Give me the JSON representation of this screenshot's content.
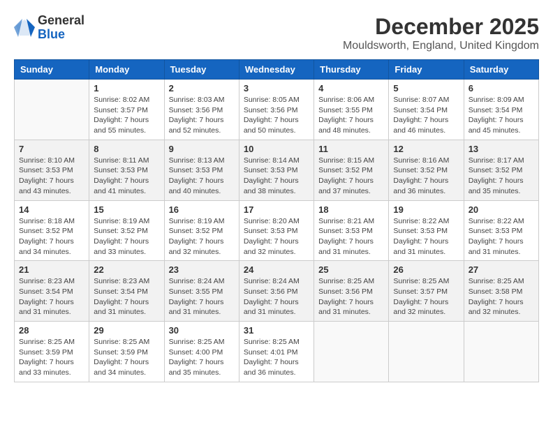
{
  "logo": {
    "general": "General",
    "blue": "Blue"
  },
  "title": "December 2025",
  "location": "Mouldsworth, England, United Kingdom",
  "days_of_week": [
    "Sunday",
    "Monday",
    "Tuesday",
    "Wednesday",
    "Thursday",
    "Friday",
    "Saturday"
  ],
  "weeks": [
    [
      {
        "day": "",
        "info": ""
      },
      {
        "day": "1",
        "info": "Sunrise: 8:02 AM\nSunset: 3:57 PM\nDaylight: 7 hours\nand 55 minutes."
      },
      {
        "day": "2",
        "info": "Sunrise: 8:03 AM\nSunset: 3:56 PM\nDaylight: 7 hours\nand 52 minutes."
      },
      {
        "day": "3",
        "info": "Sunrise: 8:05 AM\nSunset: 3:56 PM\nDaylight: 7 hours\nand 50 minutes."
      },
      {
        "day": "4",
        "info": "Sunrise: 8:06 AM\nSunset: 3:55 PM\nDaylight: 7 hours\nand 48 minutes."
      },
      {
        "day": "5",
        "info": "Sunrise: 8:07 AM\nSunset: 3:54 PM\nDaylight: 7 hours\nand 46 minutes."
      },
      {
        "day": "6",
        "info": "Sunrise: 8:09 AM\nSunset: 3:54 PM\nDaylight: 7 hours\nand 45 minutes."
      }
    ],
    [
      {
        "day": "7",
        "info": "Sunrise: 8:10 AM\nSunset: 3:53 PM\nDaylight: 7 hours\nand 43 minutes."
      },
      {
        "day": "8",
        "info": "Sunrise: 8:11 AM\nSunset: 3:53 PM\nDaylight: 7 hours\nand 41 minutes."
      },
      {
        "day": "9",
        "info": "Sunrise: 8:13 AM\nSunset: 3:53 PM\nDaylight: 7 hours\nand 40 minutes."
      },
      {
        "day": "10",
        "info": "Sunrise: 8:14 AM\nSunset: 3:53 PM\nDaylight: 7 hours\nand 38 minutes."
      },
      {
        "day": "11",
        "info": "Sunrise: 8:15 AM\nSunset: 3:52 PM\nDaylight: 7 hours\nand 37 minutes."
      },
      {
        "day": "12",
        "info": "Sunrise: 8:16 AM\nSunset: 3:52 PM\nDaylight: 7 hours\nand 36 minutes."
      },
      {
        "day": "13",
        "info": "Sunrise: 8:17 AM\nSunset: 3:52 PM\nDaylight: 7 hours\nand 35 minutes."
      }
    ],
    [
      {
        "day": "14",
        "info": "Sunrise: 8:18 AM\nSunset: 3:52 PM\nDaylight: 7 hours\nand 34 minutes."
      },
      {
        "day": "15",
        "info": "Sunrise: 8:19 AM\nSunset: 3:52 PM\nDaylight: 7 hours\nand 33 minutes."
      },
      {
        "day": "16",
        "info": "Sunrise: 8:19 AM\nSunset: 3:52 PM\nDaylight: 7 hours\nand 32 minutes."
      },
      {
        "day": "17",
        "info": "Sunrise: 8:20 AM\nSunset: 3:53 PM\nDaylight: 7 hours\nand 32 minutes."
      },
      {
        "day": "18",
        "info": "Sunrise: 8:21 AM\nSunset: 3:53 PM\nDaylight: 7 hours\nand 31 minutes."
      },
      {
        "day": "19",
        "info": "Sunrise: 8:22 AM\nSunset: 3:53 PM\nDaylight: 7 hours\nand 31 minutes."
      },
      {
        "day": "20",
        "info": "Sunrise: 8:22 AM\nSunset: 3:53 PM\nDaylight: 7 hours\nand 31 minutes."
      }
    ],
    [
      {
        "day": "21",
        "info": "Sunrise: 8:23 AM\nSunset: 3:54 PM\nDaylight: 7 hours\nand 31 minutes."
      },
      {
        "day": "22",
        "info": "Sunrise: 8:23 AM\nSunset: 3:54 PM\nDaylight: 7 hours\nand 31 minutes."
      },
      {
        "day": "23",
        "info": "Sunrise: 8:24 AM\nSunset: 3:55 PM\nDaylight: 7 hours\nand 31 minutes."
      },
      {
        "day": "24",
        "info": "Sunrise: 8:24 AM\nSunset: 3:56 PM\nDaylight: 7 hours\nand 31 minutes."
      },
      {
        "day": "25",
        "info": "Sunrise: 8:25 AM\nSunset: 3:56 PM\nDaylight: 7 hours\nand 31 minutes."
      },
      {
        "day": "26",
        "info": "Sunrise: 8:25 AM\nSunset: 3:57 PM\nDaylight: 7 hours\nand 32 minutes."
      },
      {
        "day": "27",
        "info": "Sunrise: 8:25 AM\nSunset: 3:58 PM\nDaylight: 7 hours\nand 32 minutes."
      }
    ],
    [
      {
        "day": "28",
        "info": "Sunrise: 8:25 AM\nSunset: 3:59 PM\nDaylight: 7 hours\nand 33 minutes."
      },
      {
        "day": "29",
        "info": "Sunrise: 8:25 AM\nSunset: 3:59 PM\nDaylight: 7 hours\nand 34 minutes."
      },
      {
        "day": "30",
        "info": "Sunrise: 8:25 AM\nSunset: 4:00 PM\nDaylight: 7 hours\nand 35 minutes."
      },
      {
        "day": "31",
        "info": "Sunrise: 8:25 AM\nSunset: 4:01 PM\nDaylight: 7 hours\nand 36 minutes."
      },
      {
        "day": "",
        "info": ""
      },
      {
        "day": "",
        "info": ""
      },
      {
        "day": "",
        "info": ""
      }
    ]
  ]
}
